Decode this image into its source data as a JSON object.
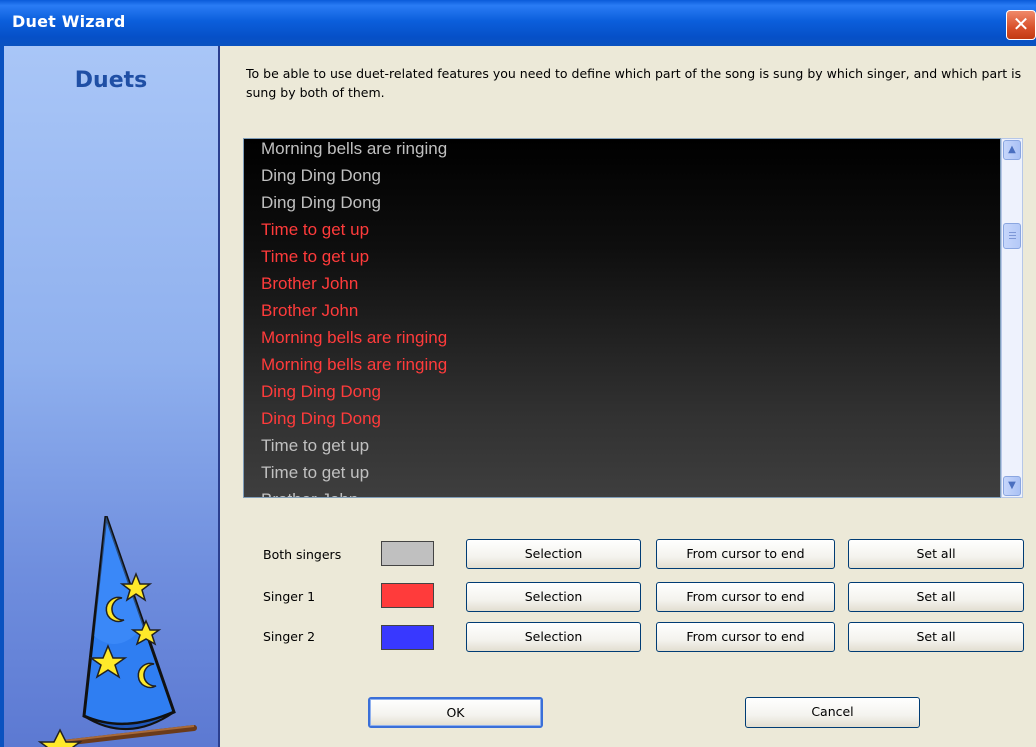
{
  "window": {
    "title": "Duet Wizard",
    "close_glyph": "✕"
  },
  "sidebar": {
    "title": "Duets",
    "art_icon": "wizard-hat-icon"
  },
  "intro_text": "To be able to use duet-related features you need to define which part of the song is sung by which singer, and which part is sung by both of them.",
  "colors": {
    "both_singers": "#c0c0c0",
    "singer1": "#ff3b3b",
    "singer2": "#3838ff"
  },
  "lyrics": [
    {
      "text": "Morning bells are ringing",
      "singer": "both"
    },
    {
      "text": "Ding Ding Dong",
      "singer": "both"
    },
    {
      "text": "Ding Ding Dong",
      "singer": "both"
    },
    {
      "text": "Time to get up",
      "singer": "singer1"
    },
    {
      "text": "Time to get up",
      "singer": "singer1"
    },
    {
      "text": "Brother John",
      "singer": "singer1"
    },
    {
      "text": "Brother John",
      "singer": "singer1"
    },
    {
      "text": "Morning bells are ringing",
      "singer": "singer1"
    },
    {
      "text": "Morning bells are ringing",
      "singer": "singer1"
    },
    {
      "text": "Ding Ding Dong",
      "singer": "singer1"
    },
    {
      "text": "Ding Ding Dong",
      "singer": "singer1"
    },
    {
      "text": "Time to get up",
      "singer": "both"
    },
    {
      "text": "Time to get up",
      "singer": "both"
    },
    {
      "text": "Brother John",
      "singer": "both"
    }
  ],
  "singer_rows": [
    {
      "label": "Both singers",
      "color_key": "both_singers"
    },
    {
      "label": "Singer 1",
      "color_key": "singer1"
    },
    {
      "label": "Singer 2",
      "color_key": "singer2"
    }
  ],
  "buttons": {
    "selection": "Selection",
    "from_cursor": "From cursor to end",
    "set_all": "Set all",
    "ok": "OK",
    "cancel": "Cancel"
  },
  "scrollbar": {
    "up_glyph": "▲",
    "down_glyph": "▼"
  }
}
